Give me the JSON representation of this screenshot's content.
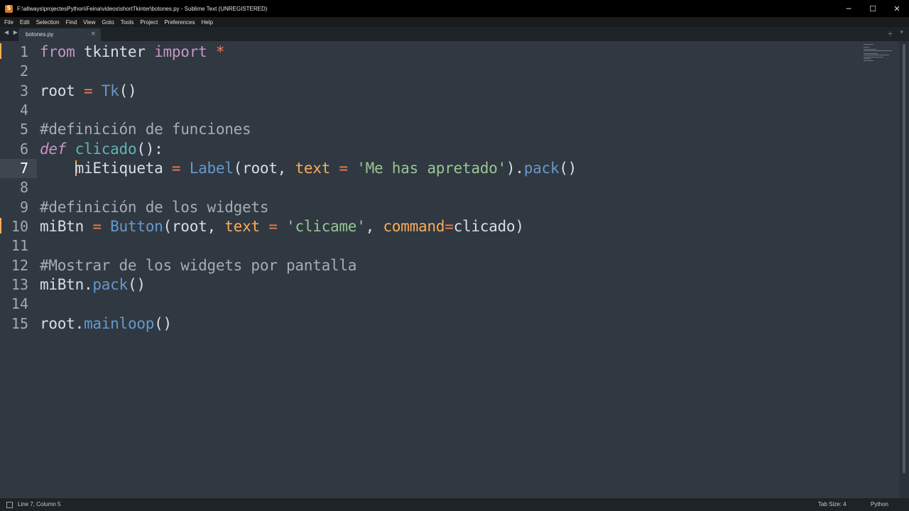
{
  "window": {
    "title": "F:\\allways\\projectesPython\\Feina\\videos\\shortTkinter\\botones.py - Sublime Text (UNREGISTERED)",
    "controls": {
      "minimize": "─",
      "maximize": "☐",
      "close": "✕"
    },
    "app_icon_letter": "S"
  },
  "menu": [
    "File",
    "Edit",
    "Selection",
    "Find",
    "View",
    "Goto",
    "Tools",
    "Project",
    "Preferences",
    "Help"
  ],
  "tabs": {
    "nav": "◀ ▶",
    "active": {
      "label": "botones.py",
      "close": "×"
    },
    "add": "+",
    "more": "▾"
  },
  "editor": {
    "current_line": 7,
    "lines": [
      {
        "n": "1"
      },
      {
        "n": "2"
      },
      {
        "n": "3"
      },
      {
        "n": "4"
      },
      {
        "n": "5"
      },
      {
        "n": "6"
      },
      {
        "n": "7"
      },
      {
        "n": "8"
      },
      {
        "n": "9"
      },
      {
        "n": "10"
      },
      {
        "n": "11"
      },
      {
        "n": "12"
      },
      {
        "n": "13"
      },
      {
        "n": "14"
      },
      {
        "n": "15"
      }
    ],
    "tokens": {
      "l1": [
        "from",
        " tkinter ",
        "import",
        " *"
      ],
      "l3": [
        "root",
        " = ",
        "Tk",
        "()"
      ],
      "l5": [
        "#definición de funciones"
      ],
      "l6": [
        "def",
        " ",
        "clicado",
        "():"
      ],
      "l7": [
        "    ",
        "miEtiqueta",
        " = ",
        "Label",
        "(root, ",
        "text",
        " = ",
        "'Me has apretado'",
        ").",
        "pack",
        "()"
      ],
      "l9": [
        "#definición de los widgets"
      ],
      "l10": [
        "miBtn",
        " = ",
        "Button",
        "(root, ",
        "text",
        " = ",
        "'clicame'",
        ", ",
        "command",
        "=",
        "clicado)"
      ],
      "l12": [
        "#Mostrar de los widgets por pantalla"
      ],
      "l13": [
        "miBtn",
        ".",
        "pack",
        "()"
      ],
      "l15": [
        "root",
        ".",
        "mainloop",
        "()"
      ]
    }
  },
  "status": {
    "position": "Line 7, Column 5",
    "tab_size": "Tab Size: 4",
    "syntax": "Python"
  },
  "colors": {
    "background": "#303841",
    "keyword": "#c695c6",
    "function_def": "#5fb4b4",
    "call": "#6699cc",
    "operator": "#f97b58",
    "string": "#99c794",
    "parameter": "#f9ae58",
    "comment": "#a6acb9",
    "plain": "#d8dee9"
  }
}
